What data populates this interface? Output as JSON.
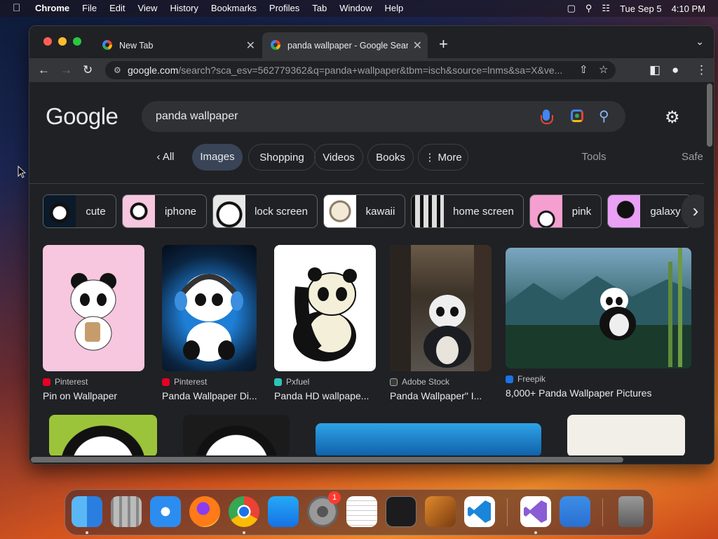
{
  "menubar": {
    "app": "Chrome",
    "items": [
      "File",
      "Edit",
      "View",
      "History",
      "Bookmarks",
      "Profiles",
      "Tab",
      "Window",
      "Help"
    ],
    "date": "Tue Sep 5",
    "time": "4:10 PM"
  },
  "browser": {
    "tabs": [
      {
        "title": "New Tab"
      },
      {
        "title": "panda wallpaper - Google Sear"
      }
    ],
    "url_host": "google.com",
    "url_rest": "/search?sca_esv=562779362&q=panda+wallpaper&tbm=isch&source=lnms&sa=X&ve..."
  },
  "search": {
    "logo": "Google",
    "query": "panda wallpaper",
    "filters": [
      "All",
      "Images",
      "Shopping",
      "Videos",
      "Books",
      "More"
    ],
    "active_filter": "Images",
    "tools": "Tools",
    "safe": "Safe"
  },
  "refinements": [
    "cute",
    "iphone",
    "lock screen",
    "kawaii",
    "home screen",
    "pink",
    "galaxy"
  ],
  "results": [
    {
      "source": "Pinterest",
      "title": "Pin on Wallpaper"
    },
    {
      "source": "Pinterest",
      "title": "Panda Wallpaper Di..."
    },
    {
      "source": "Pxfuel",
      "title": "Panda HD wallpape..."
    },
    {
      "source": "Adobe Stock",
      "title": "Panda Wallpaper\" I..."
    },
    {
      "source": "Freepik",
      "title": "8,000+ Panda Wallpaper Pictures"
    }
  ],
  "dock": {
    "apps": [
      "finder-icon",
      "launchpad-icon",
      "safari-icon",
      "firefox-icon",
      "chrome-icon",
      "app-store-icon",
      "system-settings-icon",
      "textedit-icon",
      "terminal-icon",
      "garageband-icon",
      "vscode-icon",
      "visual-studio-icon",
      "weather-icon",
      "trash-icon"
    ],
    "settings_badge": "1"
  },
  "colors": {
    "accent": "#8ab4f8",
    "active_chip": "#394457",
    "page_bg": "#202124"
  }
}
